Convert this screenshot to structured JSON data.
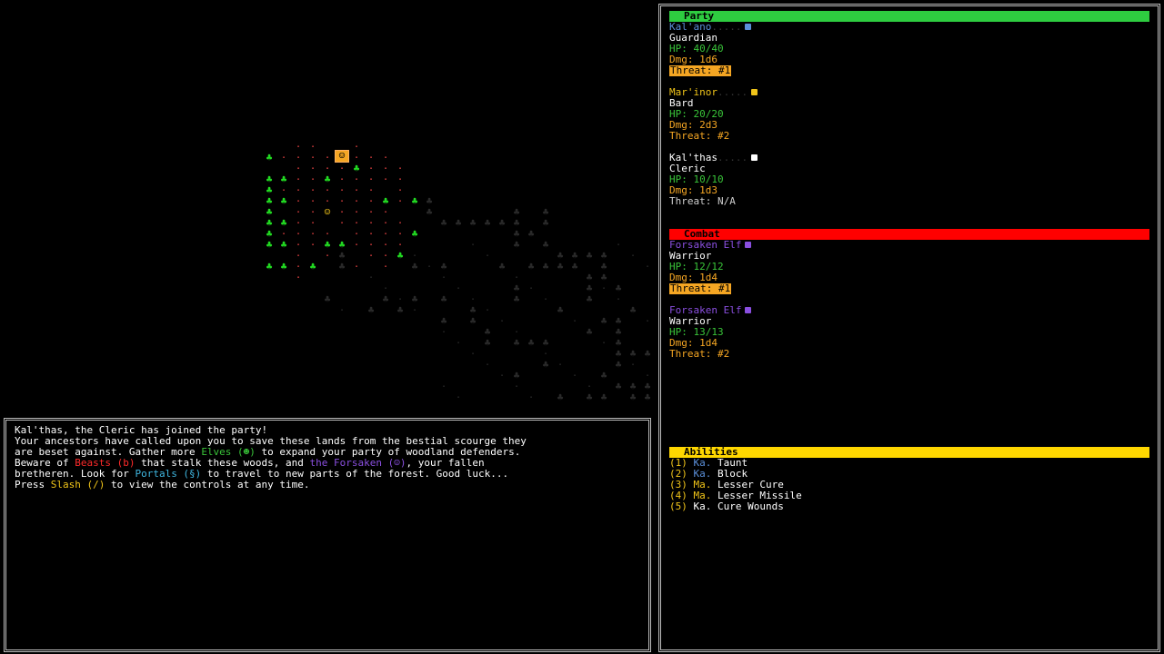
{
  "log": [
    [
      {
        "t": "Kal'thas, the Cleric has joined the party!",
        "c": "white"
      }
    ],
    [
      {
        "t": "Your ancestors have called upon you to save these lands from the bestial scourge they",
        "c": "white"
      }
    ],
    [
      {
        "t": "are beset against. Gather more ",
        "c": "white"
      },
      {
        "t": "Elves (☻)",
        "c": "green"
      },
      {
        "t": " to expand your party of woodland defenders.",
        "c": "white"
      }
    ],
    [
      {
        "t": "Beware of ",
        "c": "white"
      },
      {
        "t": "Beasts (b)",
        "c": "red"
      },
      {
        "t": " that stalk these woods, and ",
        "c": "white"
      },
      {
        "t": "the Forsaken (☺)",
        "c": "purple"
      },
      {
        "t": ", your fallen",
        "c": "white"
      }
    ],
    [
      {
        "t": "bretheren. Look for ",
        "c": "white"
      },
      {
        "t": "Portals (§)",
        "c": "cyan"
      },
      {
        "t": " to travel to new parts of the forest. Good luck...",
        "c": "white"
      }
    ],
    [
      {
        "t": "Press ",
        "c": "white"
      },
      {
        "t": "Slash (/)",
        "c": "gold"
      },
      {
        "t": " to view the controls at any time.",
        "c": "white"
      }
    ]
  ],
  "party": {
    "header": "Party",
    "header_color": "#2ecc40",
    "members": [
      {
        "name": "Kal'ano",
        "name_color": "#5b8fd9",
        "dots": ".....",
        "marker_color": "#5b8fd9",
        "cls": "Guardian",
        "hp": "HP: 40/40",
        "dmg": "Dmg: 1d6",
        "threat": "Threat: #1",
        "threat_highlight": true
      },
      {
        "name": "Mar'inor",
        "name_color": "#f0c419",
        "dots": ".....",
        "marker_color": "#f0c419",
        "cls": "Bard",
        "hp": "HP: 20/20",
        "dmg": "Dmg: 2d3",
        "threat": "Threat: #2",
        "threat_highlight": false
      },
      {
        "name": "Kal'thas",
        "name_color": "#ffffff",
        "dots": ".....",
        "marker_color": "#ffffff",
        "cls": "Cleric",
        "hp": "HP: 10/10",
        "dmg": "Dmg: 1d3",
        "threat": "Threat: N/A",
        "threat_highlight": false,
        "threat_grey": true
      }
    ]
  },
  "combat": {
    "header": "Combat",
    "header_color": "#ff0000",
    "enemies": [
      {
        "name": "Forsaken Elf",
        "name_color": "#8a4fe0",
        "marker_color": "#8a4fe0",
        "cls": "Warrior",
        "hp": "HP: 12/12",
        "dmg": "Dmg: 1d4",
        "threat": "Threat: #1",
        "threat_highlight": true
      },
      {
        "name": "Forsaken Elf",
        "name_color": "#8a4fe0",
        "marker_color": "#8a4fe0",
        "cls": "Warrior",
        "hp": "HP: 13/13",
        "dmg": "Dmg: 1d4",
        "threat": "Threat: #2",
        "threat_highlight": false
      }
    ]
  },
  "abilities": {
    "header": "Abilities",
    "header_color": "#ffd700",
    "items": [
      {
        "key": "(1)",
        "who": "Ka.",
        "who_color": "#5b8fd9",
        "name": "Taunt"
      },
      {
        "key": "(2)",
        "who": "Ka.",
        "who_color": "#5b8fd9",
        "name": "Block"
      },
      {
        "key": "(3)",
        "who": "Ma.",
        "who_color": "#f0c419",
        "name": "Lesser Cure"
      },
      {
        "key": "(4)",
        "who": "Ma.",
        "who_color": "#f0c419",
        "name": "Lesser Missile"
      },
      {
        "key": "(5)",
        "who": "Ka.",
        "who_color": "#ffffff",
        "name": "Cure Wounds"
      }
    ]
  },
  "map": {
    "player_glyph": "☺",
    "player_color": "#f0c419",
    "portal_glyph": "☺",
    "portal_color": "#f5a623",
    "tree_glyph": "♣",
    "tree_color": "#22dd22",
    "dark_tree_color": "#2a2a2a",
    "floor_glyph": "·",
    "floor_color": "#e04040",
    "dark_floor_color": "#2a2a2a"
  }
}
